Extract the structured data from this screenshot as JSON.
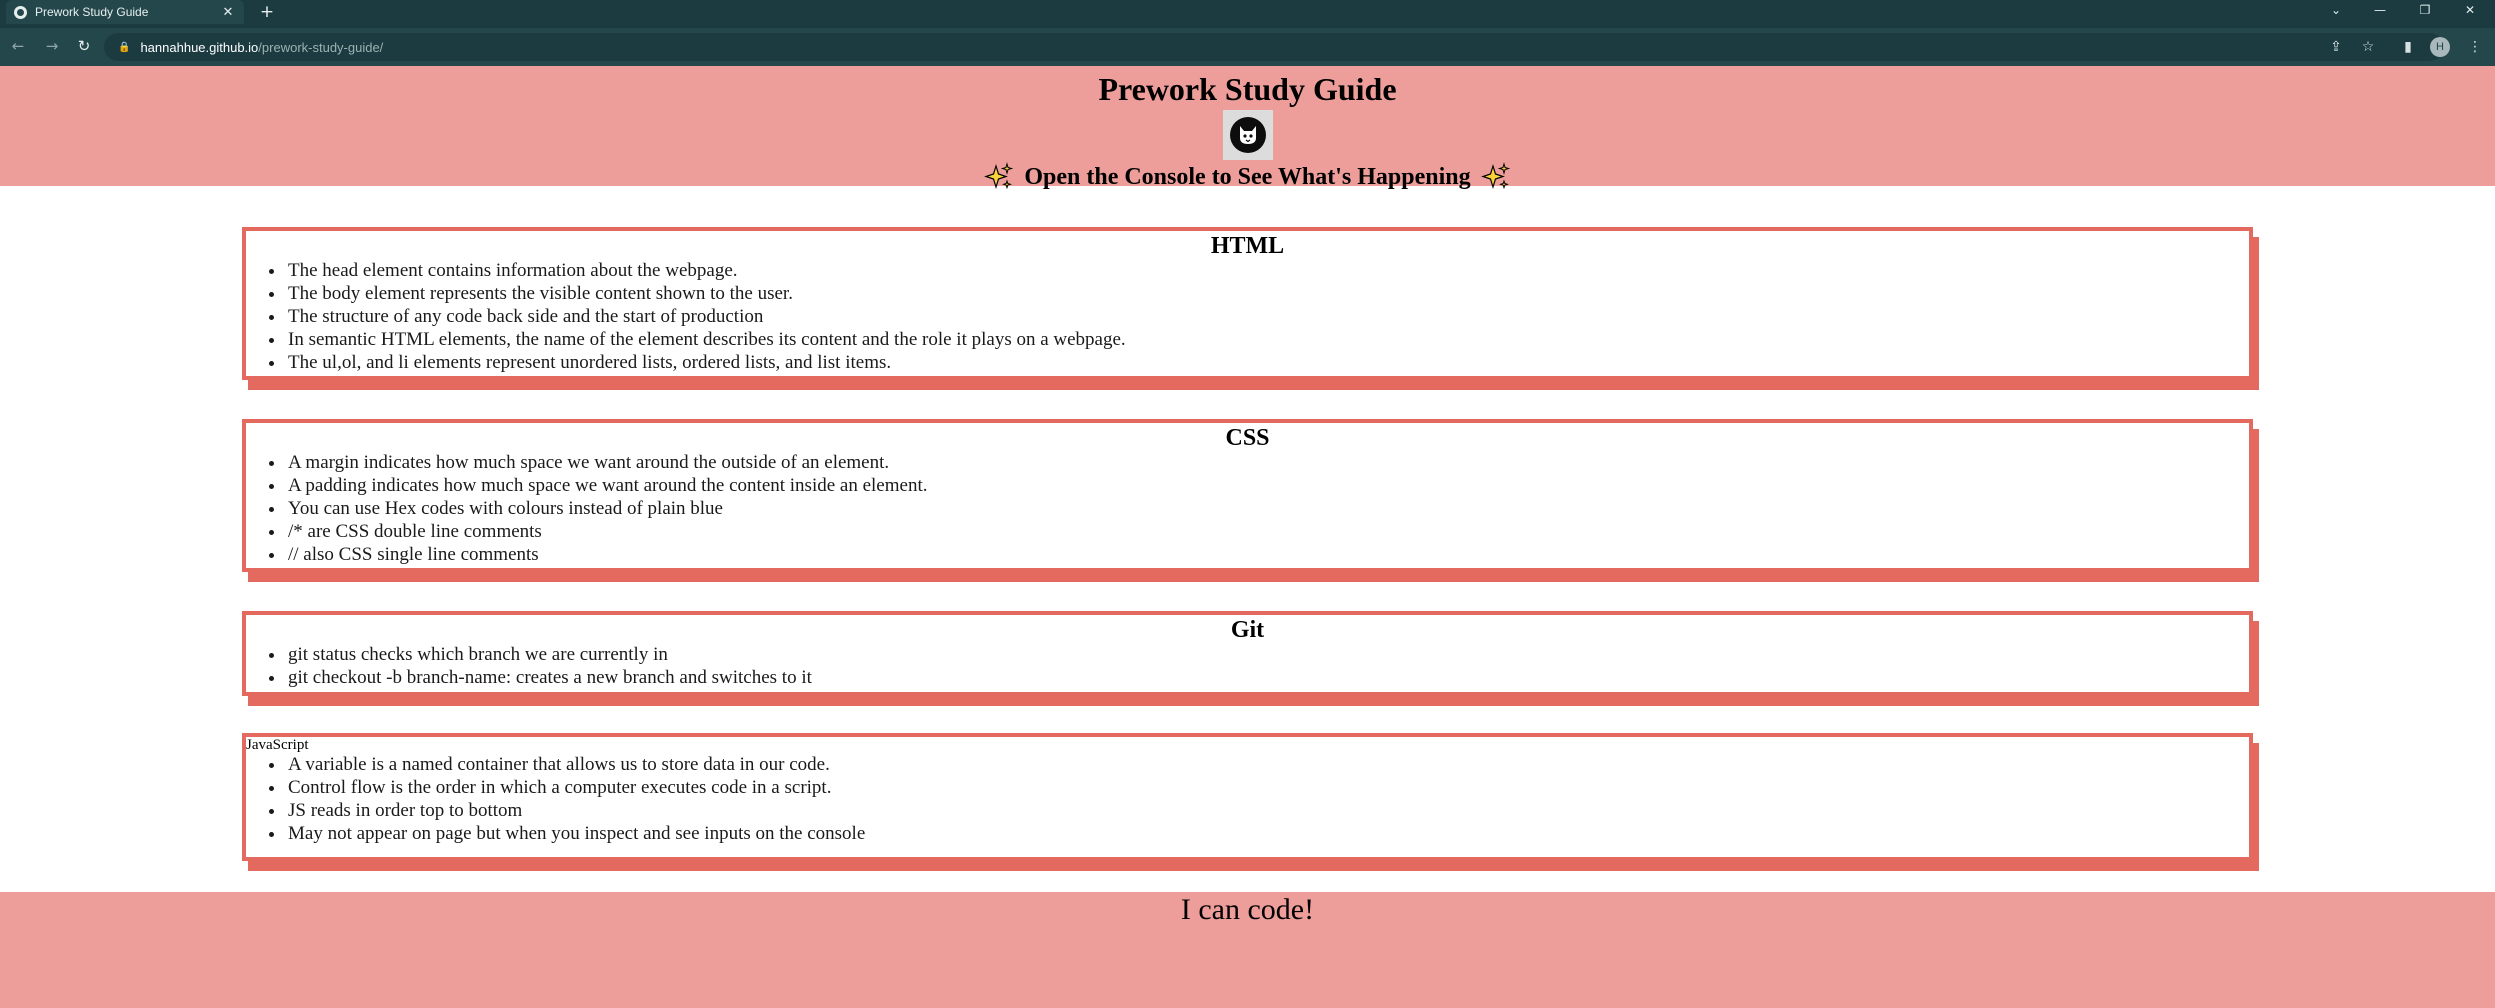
{
  "browser": {
    "tab_title": "Prework Study Guide",
    "tab_close": "✕",
    "new_tab": "+",
    "url_host": "hannahhue.github.io",
    "url_path": "/prework-study-guide/",
    "profile_initial": "H",
    "icons": {
      "back": "←",
      "forward": "→",
      "reload": "↻",
      "lock": "🔒",
      "share": "⇪",
      "star": "☆",
      "sidebar": "▮",
      "menu": "⋮",
      "tab_list": "⌄",
      "minimize": "—",
      "restore": "❐",
      "close": "✕"
    }
  },
  "header": {
    "title": "Prework Study Guide",
    "subtitle": "Open the Console to See What's Happening"
  },
  "sections": {
    "html": {
      "title": "HTML",
      "items": [
        "The head element contains information about the webpage.",
        "The body element represents the visible content shown to the user.",
        "The structure of any code back side and the start of production",
        "In semantic HTML elements, the name of the element describes its content and the role it plays on a webpage.",
        "The ul,ol, and li elements represent unordered lists, ordered lists, and list items."
      ]
    },
    "css": {
      "title": "CSS",
      "items": [
        "A margin indicates how much space we want around the outside of an element.",
        "A padding indicates how much space we want around the content inside an element.",
        "You can use Hex codes with colours instead of plain blue",
        "/* are CSS double line comments",
        "// also CSS single line comments"
      ]
    },
    "git": {
      "title": "Git",
      "items": [
        "git status checks which branch we are currently in",
        "git checkout -b branch-name: creates a new branch and switches to it"
      ]
    },
    "javascript": {
      "title": "JavaScript",
      "items": [
        "A variable is a named container that allows us to store data in our code.",
        "Control flow is the order in which a computer executes code in a script.",
        "JS reads in order top to bottom",
        "May not appear on page but when you inspect and see inputs on the console"
      ]
    }
  },
  "footer": {
    "text": "I can code!"
  },
  "colors": {
    "chrome_dark": "#1b3b40",
    "chrome_toolbar": "#24474c",
    "header_bg": "#ee9e9a",
    "card_border": "#e4695f"
  }
}
